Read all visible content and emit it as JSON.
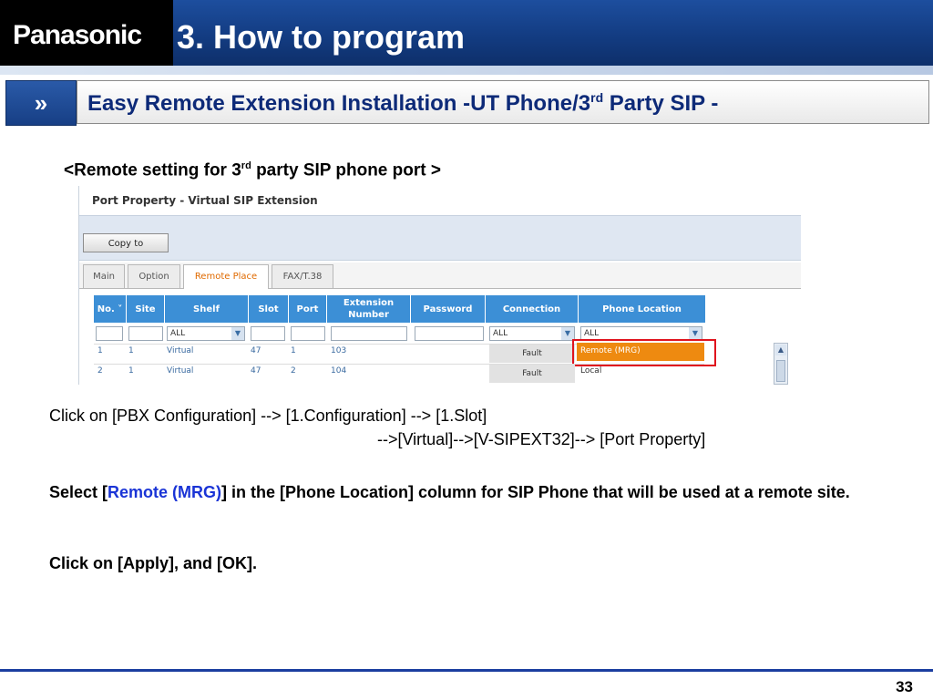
{
  "header": {
    "logo": "Panasonic",
    "title": "3. How to program"
  },
  "subheader": {
    "icon": "double-chevron-right-icon",
    "title_part1": "Easy Remote Extension Installation  -UT Phone/3",
    "title_sup": "rd",
    "title_part2": " Party SIP -"
  },
  "remote_heading": {
    "part1": "<Remote setting for 3",
    "sup": "rd",
    "part2": " party SIP phone port >"
  },
  "screenshot": {
    "title": "Port Property - Virtual SIP Extension",
    "copy_button": "Copy to",
    "tabs": [
      "Main",
      "Option",
      "Remote Place",
      "FAX/T.38"
    ],
    "active_tab": "Remote Place",
    "columns": [
      "No. ˅",
      "Site",
      "Shelf",
      "Slot",
      "Port",
      "Extension Number",
      "Password",
      "Connection",
      "Phone Location"
    ],
    "filters": {
      "shelf": "ALL",
      "connection": "ALL",
      "phone_location": "ALL"
    },
    "rows": [
      {
        "no": "1",
        "site": "1",
        "shelf": "Virtual",
        "slot": "47",
        "port": "1",
        "extension": "103",
        "password": "",
        "connection": "Fault",
        "phone_location": "Remote (MRG)"
      },
      {
        "no": "2",
        "site": "1",
        "shelf": "Virtual",
        "slot": "47",
        "port": "2",
        "extension": "104",
        "password": "",
        "connection": "Fault",
        "phone_location": "Local"
      }
    ]
  },
  "instructions": {
    "line1": "Click on [PBX Configuration] --> [1.Configuration] --> [1.Slot]",
    "line2": "-->[Virtual]-->[V-SIPEXT32]--> [Port Property]",
    "select_prefix": "Select [",
    "select_highlight": "Remote (MRG)",
    "select_suffix": "] in the [Phone Location] column for SIP Phone that will be used at a remote site.",
    "apply": "Click on [Apply], and [OK]."
  },
  "footer": {
    "page_number": "33"
  },
  "colors": {
    "header_blue": "#133c82",
    "subtitle_blue": "#0d2a78",
    "highlight_blue": "#1a34d6",
    "grid_header": "#3c8fd6",
    "remote_orange": "#ee8a10",
    "tab_active": "#e06a00",
    "highlight_box": "#e0141e"
  }
}
